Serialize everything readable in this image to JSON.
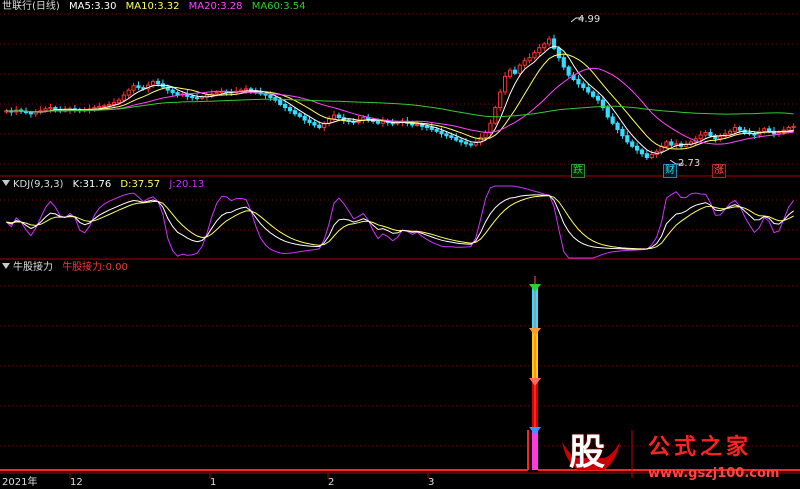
{
  "colors": {
    "ma5": "#ffffff",
    "ma10": "#ffff66",
    "ma20": "#ff44ff",
    "ma60": "#33cc33",
    "up": "#ff3333",
    "down": "#33ddff",
    "grid": "#7a0000",
    "k": "#ffffff",
    "d": "#ffff66",
    "j": "#cc33ff"
  },
  "price_panel": {
    "title": "世联行(日线)",
    "ma5": {
      "label": "MA5:",
      "value": "3.30"
    },
    "ma10": {
      "label": "MA10:",
      "value": "3.32"
    },
    "ma20": {
      "label": "MA20:",
      "value": "3.28"
    },
    "ma60": {
      "label": "MA60:",
      "value": "3.54"
    },
    "high_marker": "4.99",
    "low_marker": "2.73",
    "tags": [
      "跌",
      "财",
      "涨"
    ]
  },
  "kdj_panel": {
    "title": "KDJ(9,3,3)",
    "k": {
      "label": "K:",
      "value": "31.76"
    },
    "d": {
      "label": "D:",
      "value": "37.57"
    },
    "j": {
      "label": "J:",
      "value": "20.13"
    }
  },
  "indicator_panel": {
    "title": "牛股接力",
    "series_label": "牛股接力:",
    "series_value": "0.00"
  },
  "x_axis": {
    "labels": [
      "2021年",
      "12",
      "1",
      "2",
      "3"
    ]
  },
  "watermark": {
    "logo_char": "股",
    "site_name": "公式之家",
    "url": "www.gszj100.com"
  },
  "chart_data": [
    {
      "type": "candlestick",
      "title": "世联行(日线)",
      "ylim": [
        2.6,
        5.1
      ],
      "x": [
        0,
        1,
        2,
        3,
        4,
        5,
        6,
        7,
        8,
        9,
        10,
        11,
        12,
        13,
        14,
        15,
        16,
        17,
        18,
        19,
        20,
        21,
        22,
        23,
        24,
        25,
        26,
        27,
        28,
        29,
        30,
        31,
        32,
        33,
        34,
        35,
        36,
        37,
        38,
        39,
        40,
        41,
        42,
        43,
        44,
        45,
        46,
        47,
        48,
        49,
        50,
        51,
        52,
        53,
        54,
        55,
        56,
        57,
        58,
        59,
        60,
        61,
        62,
        63,
        64,
        65,
        66,
        67,
        68,
        69,
        70,
        71,
        72,
        73,
        74,
        75,
        76,
        77,
        78,
        79,
        80,
        81,
        82,
        83,
        84,
        85,
        86,
        87,
        88,
        89,
        90,
        91,
        92,
        93,
        94,
        95,
        96,
        97,
        98,
        99,
        100,
        101,
        102,
        103,
        104,
        105,
        106,
        107,
        108,
        109,
        110,
        111,
        112,
        113,
        114,
        115,
        116,
        117,
        118,
        119,
        120,
        121,
        122,
        123,
        124,
        125,
        126,
        127,
        128,
        129,
        130,
        131,
        132,
        133,
        134,
        135,
        136,
        137,
        138,
        139,
        140,
        141,
        142,
        143,
        144,
        145,
        146,
        147,
        148,
        149,
        150,
        151,
        152,
        153,
        154,
        155,
        156,
        157,
        158,
        159
      ],
      "close": [
        3.55,
        3.53,
        3.56,
        3.54,
        3.52,
        3.5,
        3.53,
        3.55,
        3.58,
        3.6,
        3.57,
        3.55,
        3.56,
        3.58,
        3.57,
        3.55,
        3.56,
        3.58,
        3.6,
        3.62,
        3.63,
        3.65,
        3.68,
        3.72,
        3.8,
        3.88,
        3.95,
        3.92,
        3.9,
        3.96,
        4.02,
        3.98,
        3.93,
        3.88,
        3.84,
        3.8,
        3.82,
        3.78,
        3.76,
        3.75,
        3.77,
        3.8,
        3.82,
        3.84,
        3.86,
        3.85,
        3.84,
        3.86,
        3.88,
        3.9,
        3.87,
        3.85,
        3.82,
        3.8,
        3.76,
        3.72,
        3.65,
        3.6,
        3.55,
        3.5,
        3.46,
        3.4,
        3.36,
        3.32,
        3.28,
        3.35,
        3.42,
        3.48,
        3.44,
        3.4,
        3.38,
        3.36,
        3.4,
        3.44,
        3.41,
        3.38,
        3.35,
        3.38,
        3.36,
        3.34,
        3.36,
        3.38,
        3.35,
        3.32,
        3.33,
        3.3,
        3.28,
        3.25,
        3.22,
        3.18,
        3.15,
        3.12,
        3.08,
        3.05,
        3.02,
        3.0,
        3.05,
        3.12,
        3.2,
        3.35,
        3.6,
        3.85,
        4.1,
        4.2,
        4.15,
        4.28,
        4.35,
        4.4,
        4.48,
        4.56,
        4.62,
        4.7,
        4.55,
        4.4,
        4.25,
        4.12,
        4.05,
        3.98,
        3.92,
        3.85,
        3.78,
        3.72,
        3.6,
        3.45,
        3.35,
        3.25,
        3.15,
        3.05,
        2.98,
        2.92,
        2.86,
        2.8,
        2.85,
        2.9,
        2.98,
        3.05,
        3.0,
        3.02,
        2.98,
        3.01,
        3.05,
        3.1,
        3.16,
        3.2,
        3.15,
        3.1,
        3.14,
        3.18,
        3.22,
        3.28,
        3.24,
        3.2,
        3.18,
        3.16,
        3.22,
        3.26,
        3.22,
        3.18,
        3.2,
        3.24,
        3.28,
        3.3
      ],
      "high_label": 4.99,
      "low_label": 2.73
    },
    {
      "type": "line",
      "title": "KDJ(9,3,3)",
      "ylim": [
        -10,
        110
      ],
      "series": [
        {
          "name": "K",
          "values": [
            31.76
          ]
        },
        {
          "name": "D",
          "values": [
            37.57
          ]
        },
        {
          "name": "J",
          "values": [
            20.13
          ]
        }
      ]
    },
    {
      "type": "bar",
      "title": "牛股接力",
      "ylim": [
        0,
        1
      ],
      "series": [
        {
          "name": "牛股接力",
          "values": [
            0.0
          ]
        }
      ]
    }
  ]
}
